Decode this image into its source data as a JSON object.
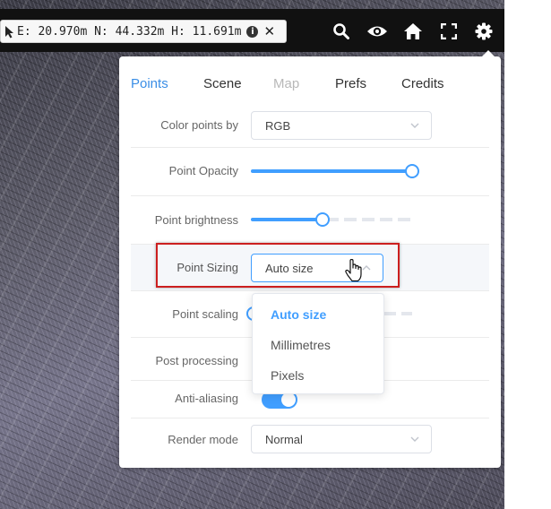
{
  "coords": {
    "text": "E: 20.970m N: 44.332m H: 11.691m",
    "info_glyph": "i",
    "close_glyph": "✕"
  },
  "toolbar": {
    "icons": [
      "search-icon",
      "eye-icon",
      "home-icon",
      "fullscreen-icon",
      "gear-icon"
    ]
  },
  "tabs": [
    {
      "label": "Points",
      "state": "active"
    },
    {
      "label": "Scene",
      "state": "normal"
    },
    {
      "label": "Map",
      "state": "disabled"
    },
    {
      "label": "Prefs",
      "state": "normal"
    },
    {
      "label": "Credits",
      "state": "normal"
    }
  ],
  "settings": {
    "color_points_by": {
      "label": "Color points by",
      "value": "RGB"
    },
    "point_opacity": {
      "label": "Point Opacity",
      "level": 1.0
    },
    "point_brightness": {
      "label": "Point brightness",
      "level": 0.45
    },
    "point_sizing": {
      "label": "Point Sizing",
      "value": "Auto size"
    },
    "point_scaling": {
      "label": "Point scaling"
    },
    "post_processing": {
      "label": "Post processing"
    },
    "anti_aliasing": {
      "label": "Anti-aliasing",
      "on": true
    },
    "render_mode": {
      "label": "Render mode",
      "value": "Normal"
    }
  },
  "dropdown": {
    "options": [
      "Auto size",
      "Millimetres",
      "Pixels"
    ],
    "selected": "Auto size"
  },
  "colors": {
    "accent": "#409eff",
    "highlight_box": "#cc1f1f",
    "toolbar_bg": "#111111"
  }
}
